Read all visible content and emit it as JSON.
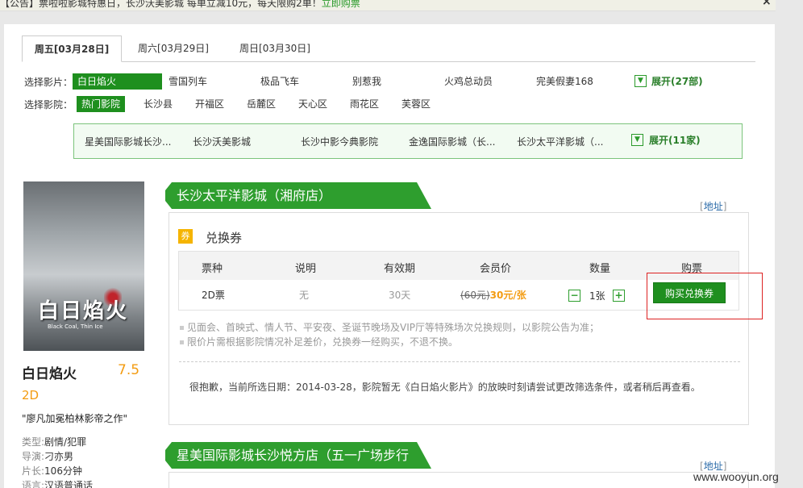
{
  "notice": {
    "text": "【公告】票啦啦影城特惠日，长沙沃美影城 每单立减10元，每天限购2单！",
    "link": "立即购票",
    "close": "×"
  },
  "date_tabs": [
    {
      "label": "周五[03月28日]",
      "active": true
    },
    {
      "label": "周六[03月29日]",
      "active": false
    },
    {
      "label": "周日[03月30日]",
      "active": false
    }
  ],
  "movie_filter": {
    "label": "选择影片：",
    "items": [
      "白日焰火",
      "雪国列车",
      "极品飞车",
      "别惹我",
      "火鸡总动员",
      "完美假妻168"
    ],
    "expand": "展开(27部)"
  },
  "district_filter": {
    "label": "选择影院：",
    "items": [
      "热门影院",
      "长沙县",
      "开福区",
      "岳麓区",
      "天心区",
      "雨花区",
      "芙蓉区"
    ]
  },
  "cinemas": {
    "items": [
      "星美国际影城长沙...",
      "长沙沃美影城",
      "长沙中影今典影院",
      "金逸国际影城（长...",
      "长沙太平洋影城（..."
    ],
    "expand": "展开(11家)"
  },
  "movie": {
    "poster_title": "白日焰火",
    "poster_subtitle": "Black Coal, Thin Ice",
    "name": "白日焰火",
    "score": "7.5",
    "format": "2D",
    "quote": "\"廖凡加冕柏林影帝之作\"",
    "info": [
      {
        "key": "类型:",
        "value": "剧情/犯罪"
      },
      {
        "key": "导演:",
        "value": "刁亦男"
      },
      {
        "key": "片长:",
        "value": "106分钟"
      },
      {
        "key": "语言:",
        "value": "汉语普通话"
      }
    ]
  },
  "cinema_section": {
    "name": "长沙太平洋影城（湘府店）",
    "address_link": "地址",
    "coupon_icon": "券",
    "coupon_title": "兑换券",
    "table_headers": [
      "票种",
      "说明",
      "有效期",
      "会员价",
      "数量",
      "购票"
    ],
    "row": {
      "type": "2D票",
      "desc": "无",
      "validity": "30天",
      "old_price": "(60元)",
      "price": "30元/张",
      "quantity": "1张",
      "minus": "−",
      "plus": "+",
      "buy": "购买兑换券"
    },
    "notes": [
      "见面会、首映式、情人节、平安夜、圣诞节晚场及VIP厅等特殊场次兑换规则，以影院公告为准；",
      "限价片需根据影院情况补足差价，兑换券一经购买，不退不换。"
    ],
    "sorry": "很抱歉，当前所选日期：2014-03-28，影院暂无《白日焰火影片》的放映时刻请尝试更改筛选条件，或者稍后再查看。"
  },
  "cinema_section2": {
    "name": "星美国际影城长沙悦方店（五一广场步行",
    "address_link": "地址"
  },
  "watermark": "www.wooyun.org"
}
